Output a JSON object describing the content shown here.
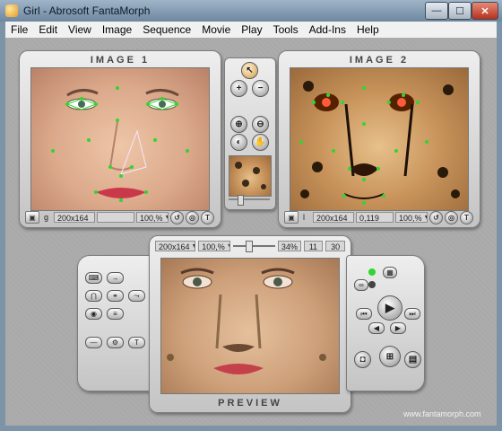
{
  "window": {
    "title": "Girl - Abrosoft FantaMorph",
    "controls": {
      "minimize": "—",
      "maximize": "☐",
      "close": "✕"
    }
  },
  "menu": [
    "File",
    "Edit",
    "View",
    "Image",
    "Sequence",
    "Movie",
    "Play",
    "Tools",
    "Add-Ins",
    "Help"
  ],
  "image1": {
    "title": "IMAGE 1",
    "status": {
      "letter": "g",
      "size": "200x164",
      "blank": "",
      "zoom": "100,%"
    }
  },
  "image2": {
    "title": "IMAGE 2",
    "status": {
      "letter": "l",
      "size": "200x164",
      "value": "0,119",
      "zoom": "100,%"
    }
  },
  "preview": {
    "title": "PREVIEW",
    "size": "200x164",
    "zoom": "100,%",
    "percent": "34%",
    "frame": "11",
    "total": "30",
    "slider_fraction": 0.34
  },
  "icon_glyphs": {
    "play": "▶",
    "add": "+",
    "remove": "−",
    "text": "T",
    "grab": "✋"
  },
  "website": "www.fantamorph.com",
  "colors": {
    "accent_dot": "#2fd62f",
    "window_title": "#6e879f"
  }
}
